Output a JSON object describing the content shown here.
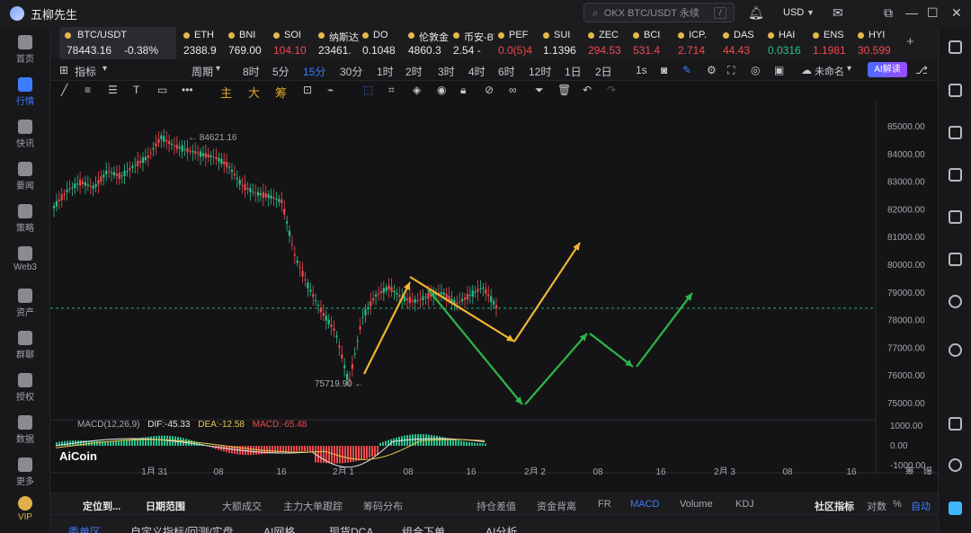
{
  "app": {
    "title": "五柳先生"
  },
  "search": {
    "placeholder": "OKX BTC/USDT 永续"
  },
  "currency": "USD",
  "sidebar": [
    {
      "label": "首页",
      "icon": "home-icon"
    },
    {
      "label": "行情",
      "icon": "market-chart-icon",
      "active": true
    },
    {
      "label": "快讯",
      "icon": "flash-news-icon"
    },
    {
      "label": "要闻",
      "icon": "news-icon"
    },
    {
      "label": "策略",
      "icon": "robot-strategy-icon"
    },
    {
      "label": "Web3",
      "icon": "web3-icon"
    },
    {
      "label": "资产",
      "icon": "wallet-icon"
    },
    {
      "label": "群聊",
      "icon": "chat-icon"
    },
    {
      "label": "授权",
      "icon": "key-icon"
    },
    {
      "label": "数据",
      "icon": "data-icon"
    },
    {
      "label": "更多",
      "icon": "grid-more-icon"
    },
    {
      "label": "VIP",
      "icon": "vip-icon"
    }
  ],
  "tickers": [
    {
      "name": "BTC/USDT",
      "price": "78443.16",
      "change": "-0.38%"
    },
    {
      "name": "ETH",
      "price": "2388.9"
    },
    {
      "name": "BNI",
      "price": "769.00"
    },
    {
      "name": "SOI",
      "price": "104.10"
    },
    {
      "name": "纳斯达克",
      "price": "23461."
    },
    {
      "name": "DO",
      "price": "0.1048"
    },
    {
      "name": "伦敦金",
      "price": "4860.3"
    },
    {
      "name": "币安-BT",
      "price": "2.54 -"
    },
    {
      "name": "PEF",
      "price": "0.0(5)4"
    },
    {
      "name": "SUI",
      "price": "1.1396"
    },
    {
      "name": "ZEC",
      "price": "294.53"
    },
    {
      "name": "BCI",
      "price": "531.4"
    },
    {
      "name": "ICP.",
      "price": "2.714"
    },
    {
      "name": "DAS",
      "price": "44.43"
    },
    {
      "name": "HAI",
      "price": "0.0316"
    },
    {
      "name": "ENS",
      "price": "1.1981"
    },
    {
      "name": "HYI",
      "price": "30.599"
    }
  ],
  "toolbar1": {
    "indicator": "指标",
    "period": "周期",
    "intervals": [
      "8时",
      "5分",
      "15分",
      "30分",
      "1时",
      "2时",
      "3时",
      "4时",
      "6时",
      "12时",
      "1日",
      "2日",
      "1s"
    ],
    "active_interval": "15分",
    "layout_name": "未命名",
    "ai_button": "AI解读"
  },
  "toolbar2": {
    "main": "主",
    "big": "大",
    "chip": "筹"
  },
  "chart_data": {
    "type": "line",
    "symbol": "BTC/USDT",
    "y_ticks": [
      "85000.00",
      "84000.00",
      "83000.00",
      "82000.00",
      "81000.00",
      "80000.00",
      "79000.00",
      "78000.00",
      "77000.00",
      "76000.00",
      "75000.00"
    ],
    "x_ticks": [
      "1月 31",
      "08",
      "16",
      "2月 1",
      "08",
      "16",
      "2月 2",
      "08",
      "16",
      "2月 3",
      "08",
      "16"
    ],
    "high_label": "84621.16",
    "low_label": "75719.90",
    "current_price": 78443.16,
    "price_series": [
      82100,
      82700,
      83000,
      82800,
      83400,
      83200,
      83600,
      83900,
      84621,
      84300,
      84150,
      84000,
      83900,
      83600,
      82900,
      82600,
      82500,
      82300,
      80300,
      79200,
      78300,
      77600,
      75720,
      78100,
      78900,
      79200,
      78800,
      78700,
      78900,
      79000,
      78600,
      78900,
      79200,
      78500
    ],
    "macd": {
      "label": "MACD(12,26,9)",
      "dif": "-45.33",
      "dea": "-12.58",
      "macd": "-65.48",
      "y_ticks": [
        "1000.00",
        "0.00",
        "-1000.00"
      ]
    }
  },
  "watermark": "AiCoin",
  "bottom1": {
    "items": [
      "定位到...",
      "日期范围",
      "大额成交",
      "主力大单跟踪",
      "筹码分布",
      "持仓差值",
      "资金背离",
      "FR",
      "MACD",
      "Volume",
      "KDJ",
      "社区指标",
      "对数",
      "%",
      "自动"
    ],
    "right_labels": [
      "筹",
      "爆"
    ]
  },
  "bottom2": {
    "items": [
      "委单区",
      "自定义指标/回测/实盘",
      "AI网格",
      "现货DCA",
      "组合下单",
      "AI分析"
    ]
  }
}
